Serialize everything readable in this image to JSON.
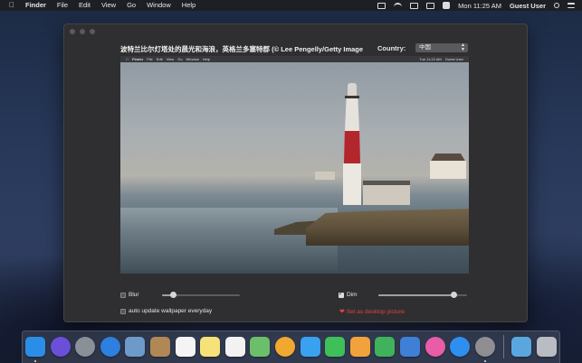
{
  "menubar": {
    "app_name": "Finder",
    "menus": [
      "File",
      "Edit",
      "View",
      "Go",
      "Window",
      "Help"
    ],
    "clock": "Mon 11:25 AM",
    "user": "Guest User"
  },
  "window": {
    "title": "波特兰比尔灯塔处的晨光和海浪，英格兰多塞特郡 (© Lee Pengelly/Getty Image",
    "country_label": "Country:",
    "country_value": "中国",
    "preview_menubar": {
      "app_name": "Finder",
      "menus": [
        "File",
        "Edit",
        "View",
        "Go",
        "Window",
        "Help"
      ],
      "clock": "Tue 11:22 AM",
      "user": "Guest User"
    },
    "blur": {
      "label": "Blur",
      "checked": false,
      "value": 0.15
    },
    "dim": {
      "label": "Dim",
      "checked": true,
      "value": 0.85
    },
    "auto_update": {
      "label": "auto update wallpaper everyday",
      "checked": false
    },
    "set_desktop_label": "Set as desktop picture"
  },
  "dock": {
    "apps": [
      {
        "name": "finder-icon",
        "color": "#2a8ee8"
      },
      {
        "name": "siri-icon",
        "color": "#6b4fd8"
      },
      {
        "name": "launchpad-icon",
        "color": "#8a8f98"
      },
      {
        "name": "safari-icon",
        "color": "#2d7fe0"
      },
      {
        "name": "mail-icon",
        "color": "#6d9ac9"
      },
      {
        "name": "contacts-icon",
        "color": "#b08855"
      },
      {
        "name": "calendar-icon",
        "color": "#f4f4f4"
      },
      {
        "name": "notes-icon",
        "color": "#f7e27a"
      },
      {
        "name": "reminders-icon",
        "color": "#f2f2f2"
      },
      {
        "name": "maps-icon",
        "color": "#6cbf6a"
      },
      {
        "name": "photos-icon",
        "color": "#f0a830"
      },
      {
        "name": "messages-icon",
        "color": "#3aa0f0"
      },
      {
        "name": "facetime-icon",
        "color": "#3fbf5a"
      },
      {
        "name": "pages-icon",
        "color": "#f2a23c"
      },
      {
        "name": "numbers-icon",
        "color": "#3fb25b"
      },
      {
        "name": "keynote-icon",
        "color": "#3f7fd6"
      },
      {
        "name": "itunes-icon",
        "color": "#e85ca8"
      },
      {
        "name": "app-store-icon",
        "color": "#2f8ff0"
      },
      {
        "name": "system-preferences-icon",
        "color": "#8e8e93"
      }
    ],
    "extras": [
      {
        "name": "downloads-folder-icon",
        "color": "#5aa7e0"
      },
      {
        "name": "trash-icon",
        "color": "#b9bcc2"
      }
    ]
  }
}
